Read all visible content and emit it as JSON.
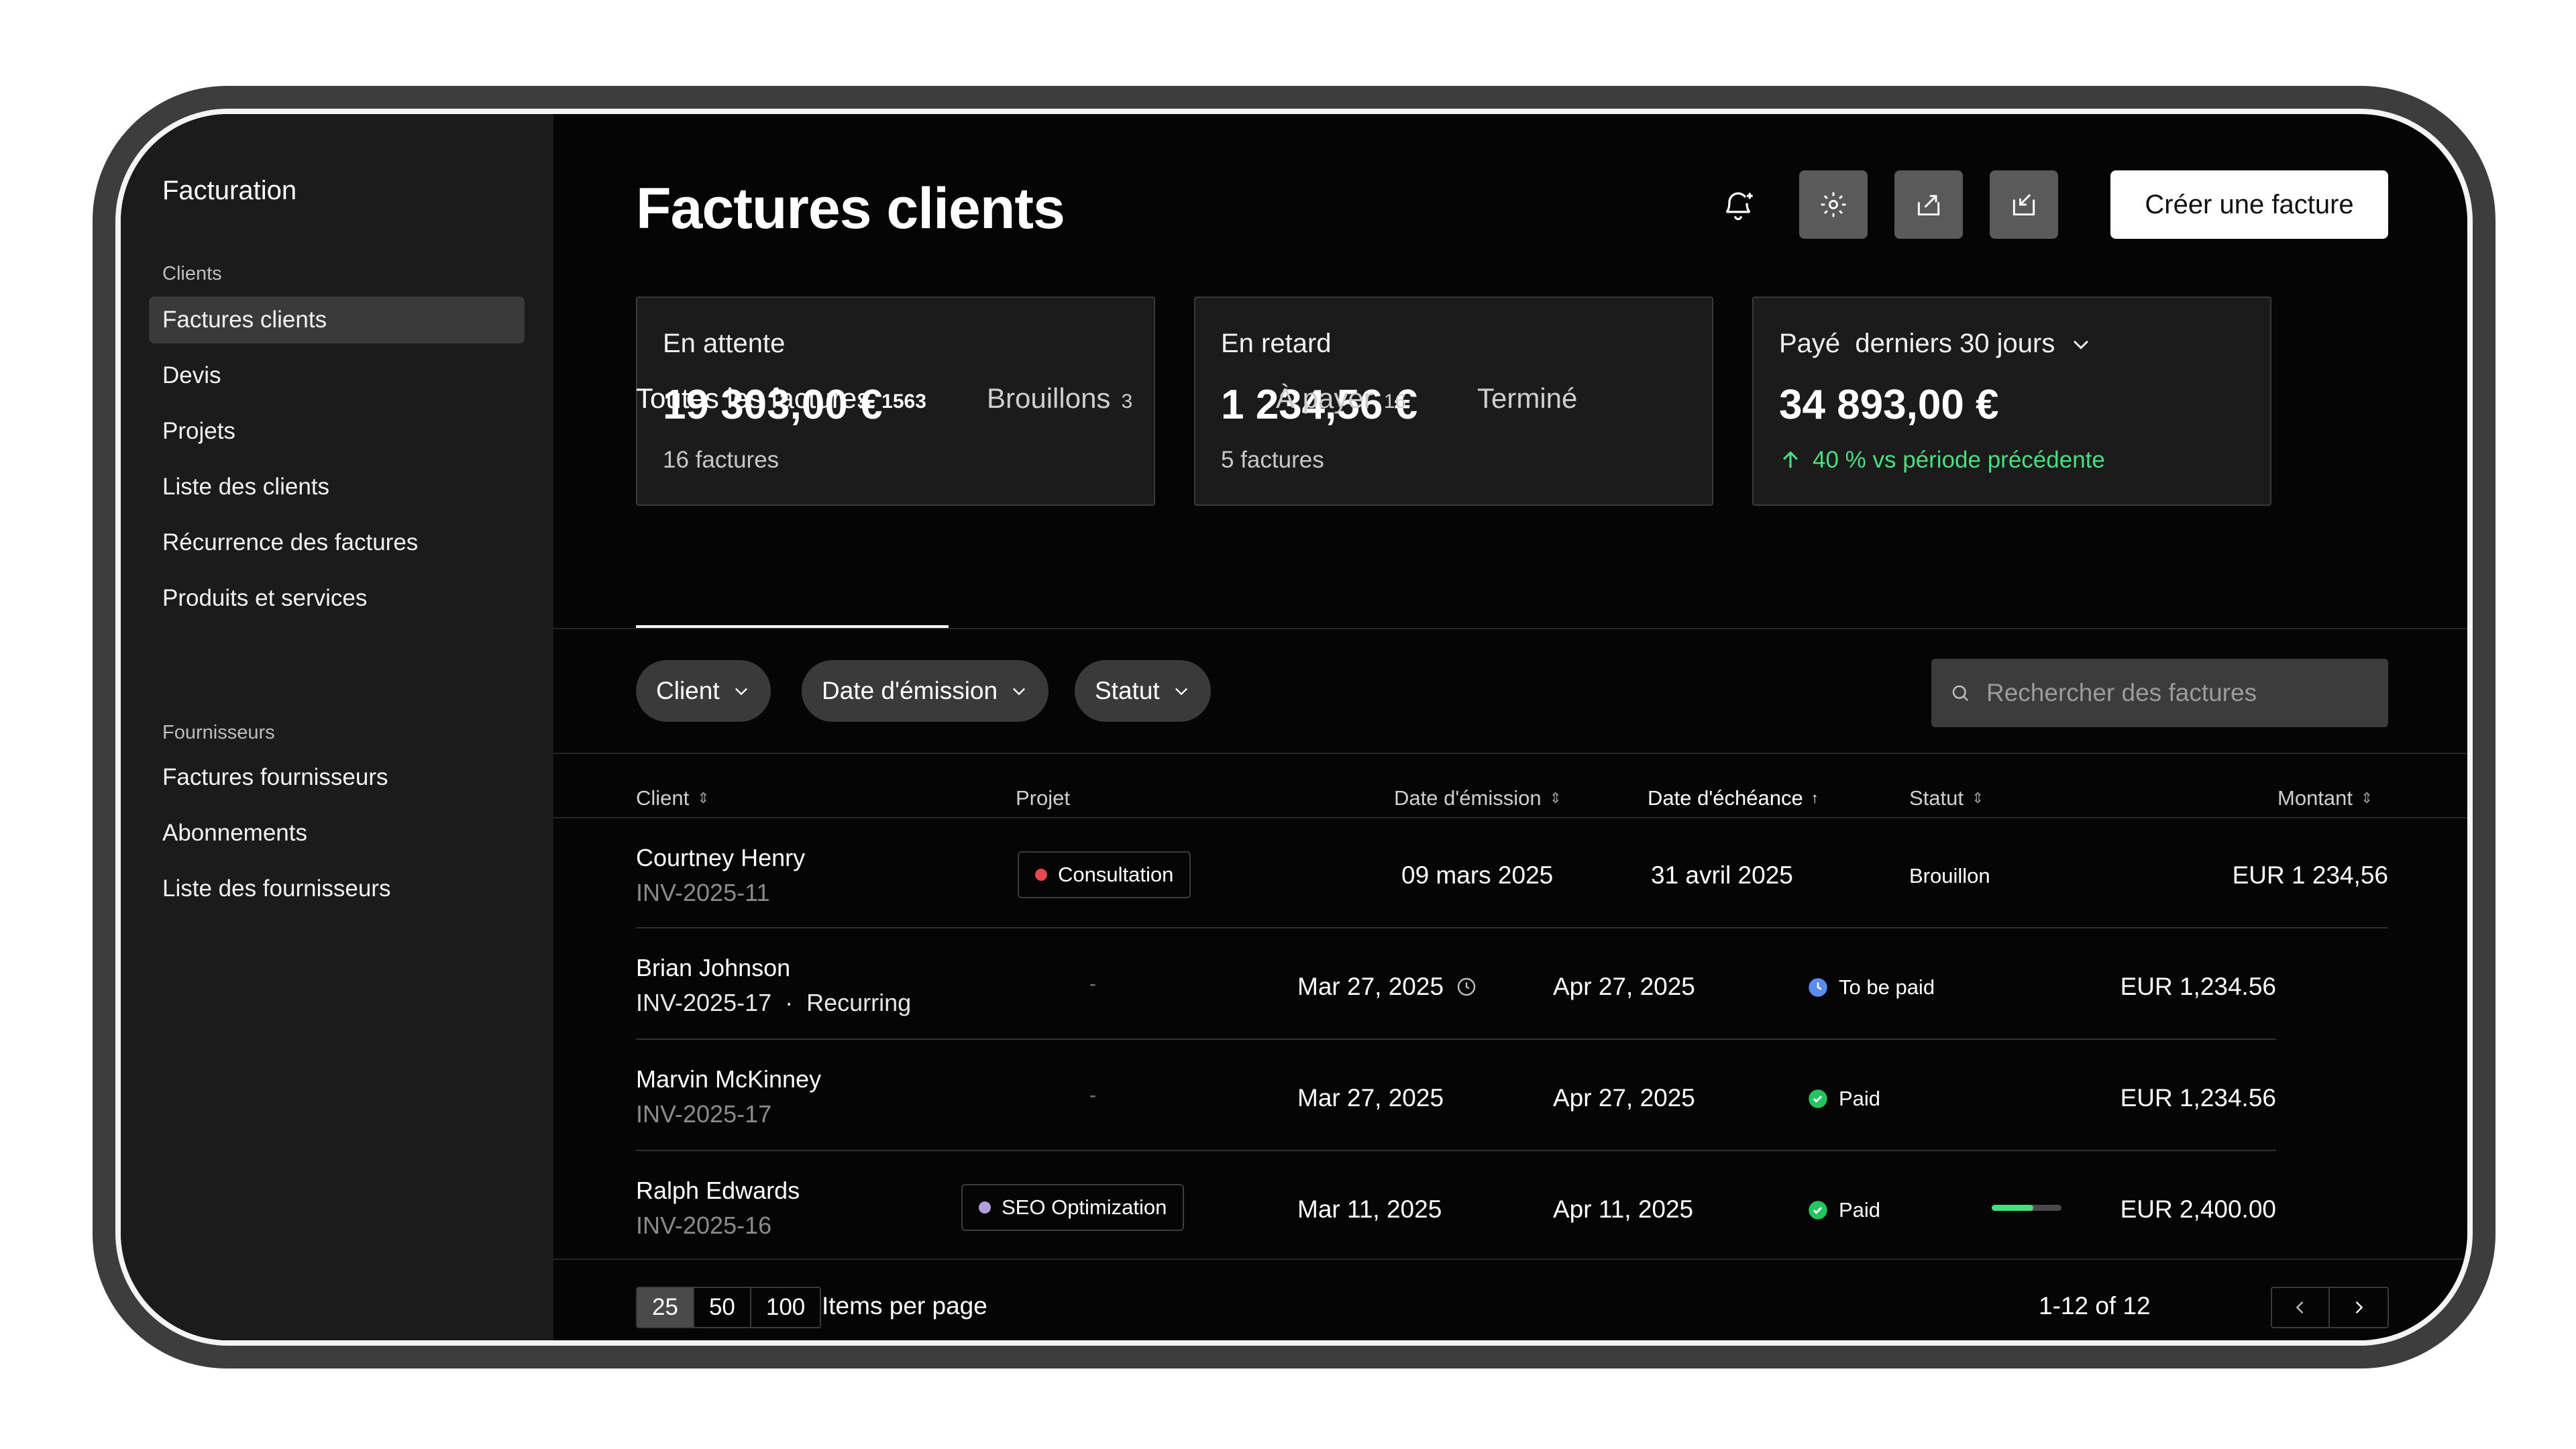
{
  "sidebar": {
    "app_title": "Facturation",
    "clients_section": "Clients",
    "clients_items": [
      "Factures clients",
      "Devis",
      "Projets",
      "Liste des clients",
      "Récurrence des factures",
      "Produits et services"
    ],
    "suppliers_section": "Fournisseurs",
    "suppliers_items": [
      "Factures fournisseurs",
      "Abonnements",
      "Liste des fournisseurs"
    ]
  },
  "header": {
    "title": "Factures clients",
    "create_button": "Créer une facture",
    "icons": [
      "notification-add-icon",
      "gear-icon",
      "export-icon",
      "import-icon"
    ]
  },
  "cards": [
    {
      "label": "En attente",
      "amount": "19 303,00 €",
      "sub": "16 factures"
    },
    {
      "label": "En retard",
      "amount": "1 234,56 €",
      "sub": "5 factures"
    },
    {
      "label": "Payé  derniers 30 jours",
      "amount": "34 893,00 €",
      "delta": "40 % vs période précédente"
    }
  ],
  "tabs": [
    {
      "label": "Toutes les factures",
      "count": "1563"
    },
    {
      "label": "Brouillons",
      "count": "3"
    },
    {
      "label": "À payer",
      "count": "16"
    },
    {
      "label": "Terminé",
      "count": ""
    }
  ],
  "filters": [
    "Client",
    "Date d'émission",
    "Statut"
  ],
  "search": {
    "placeholder": "Rechercher des factures"
  },
  "columns": [
    "Client",
    "Projet",
    "Date d'émission",
    "Date d'échéance",
    "Statut",
    "Montant"
  ],
  "rows": [
    {
      "client": "Courtney Henry",
      "invoice": "INV-2025-11",
      "project": "Consultation",
      "issued": "09 mars 2025",
      "due": "31 avril 2025",
      "status": "Brouillon",
      "amount": "EUR 1 234,56"
    },
    {
      "client": "Brian Johnson",
      "invoice": "INV-2025-17",
      "recurring": "Recurring",
      "project": "-",
      "issued": "Mar 27, 2025",
      "due": "Apr 27, 2025",
      "status": "To be paid",
      "amount": "EUR 1,234.56"
    },
    {
      "client": "Marvin McKinney",
      "invoice": "INV-2025-17",
      "project": "-",
      "issued": "Mar 27, 2025",
      "due": "Apr 27, 2025",
      "status": "Paid",
      "amount": "EUR 1,234.56"
    },
    {
      "client": "Ralph Edwards",
      "invoice": "INV-2025-16",
      "project": "SEO Optimization",
      "issued": "Mar 11, 2025",
      "due": "Apr 11, 2025",
      "status": "Paid",
      "amount": "EUR 2,400.00"
    }
  ],
  "pagination": {
    "sizes": [
      "25",
      "50",
      "100"
    ],
    "selected": "25",
    "label": "Items per page",
    "range": "1-12 of 12"
  },
  "colors": {
    "accent_green": "#4ade80",
    "status_blue": "#5b8def",
    "consultation_dot": "#e5484d",
    "seo_dot": "#b39ddb"
  }
}
